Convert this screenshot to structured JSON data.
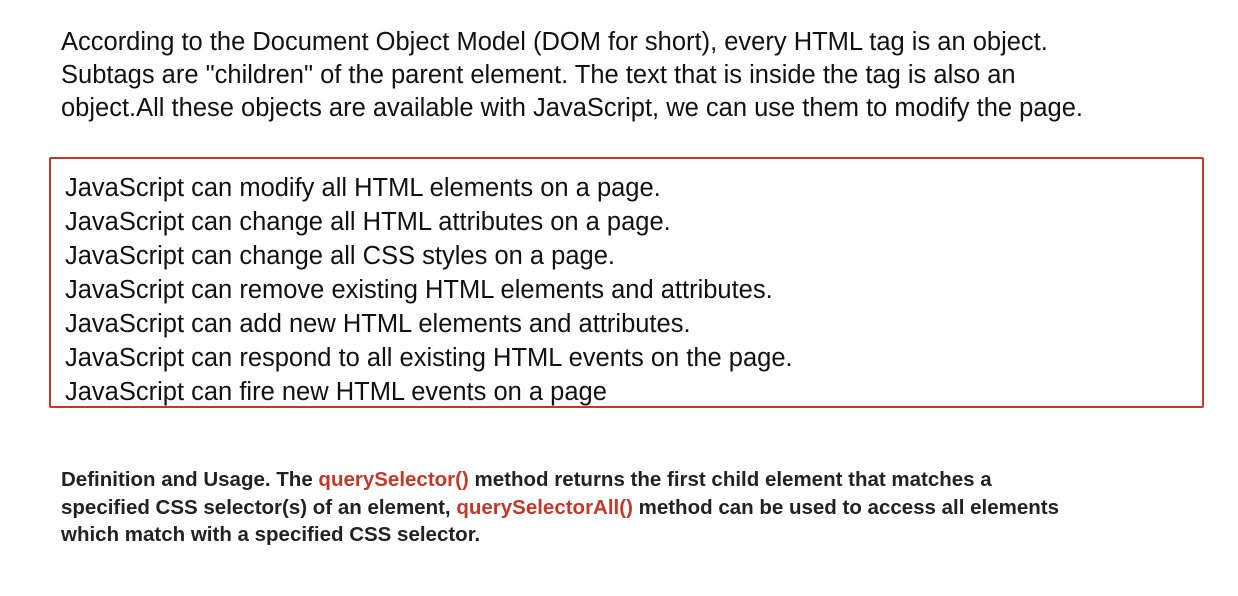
{
  "intro": {
    "lines": [
      "According to the Document Object Model (DOM for short), every HTML tag is an object.",
      "Subtags are \"children\" of the parent element. The text that is inside the tag is also an",
      "object.All these objects are available with JavaScript, we can use them to modify the page."
    ]
  },
  "capabilities": [
    "JavaScript can modify all HTML elements on a page.",
    "JavaScript can change all HTML attributes on a page.",
    "JavaScript can change all CSS styles on a page.",
    "JavaScript can remove existing HTML elements and attributes.",
    "JavaScript can add new HTML elements and attributes.",
    "JavaScript can respond to all existing HTML events on the page.",
    "JavaScript can fire new HTML events on a page"
  ],
  "definition": {
    "line1_prefix": "Definition and Usage. The ",
    "method1": "querySelector()",
    "line1_suffix": " method returns the first child element that matches a",
    "line2_prefix": "specified CSS selector(s) of an element, ",
    "method2": "querySelectorAll()",
    "line2_suffix": " method can be used to access all elements",
    "line3": "which match with a specified CSS selector."
  },
  "colors": {
    "accent_red": "#c0392b",
    "text": "#111111"
  }
}
